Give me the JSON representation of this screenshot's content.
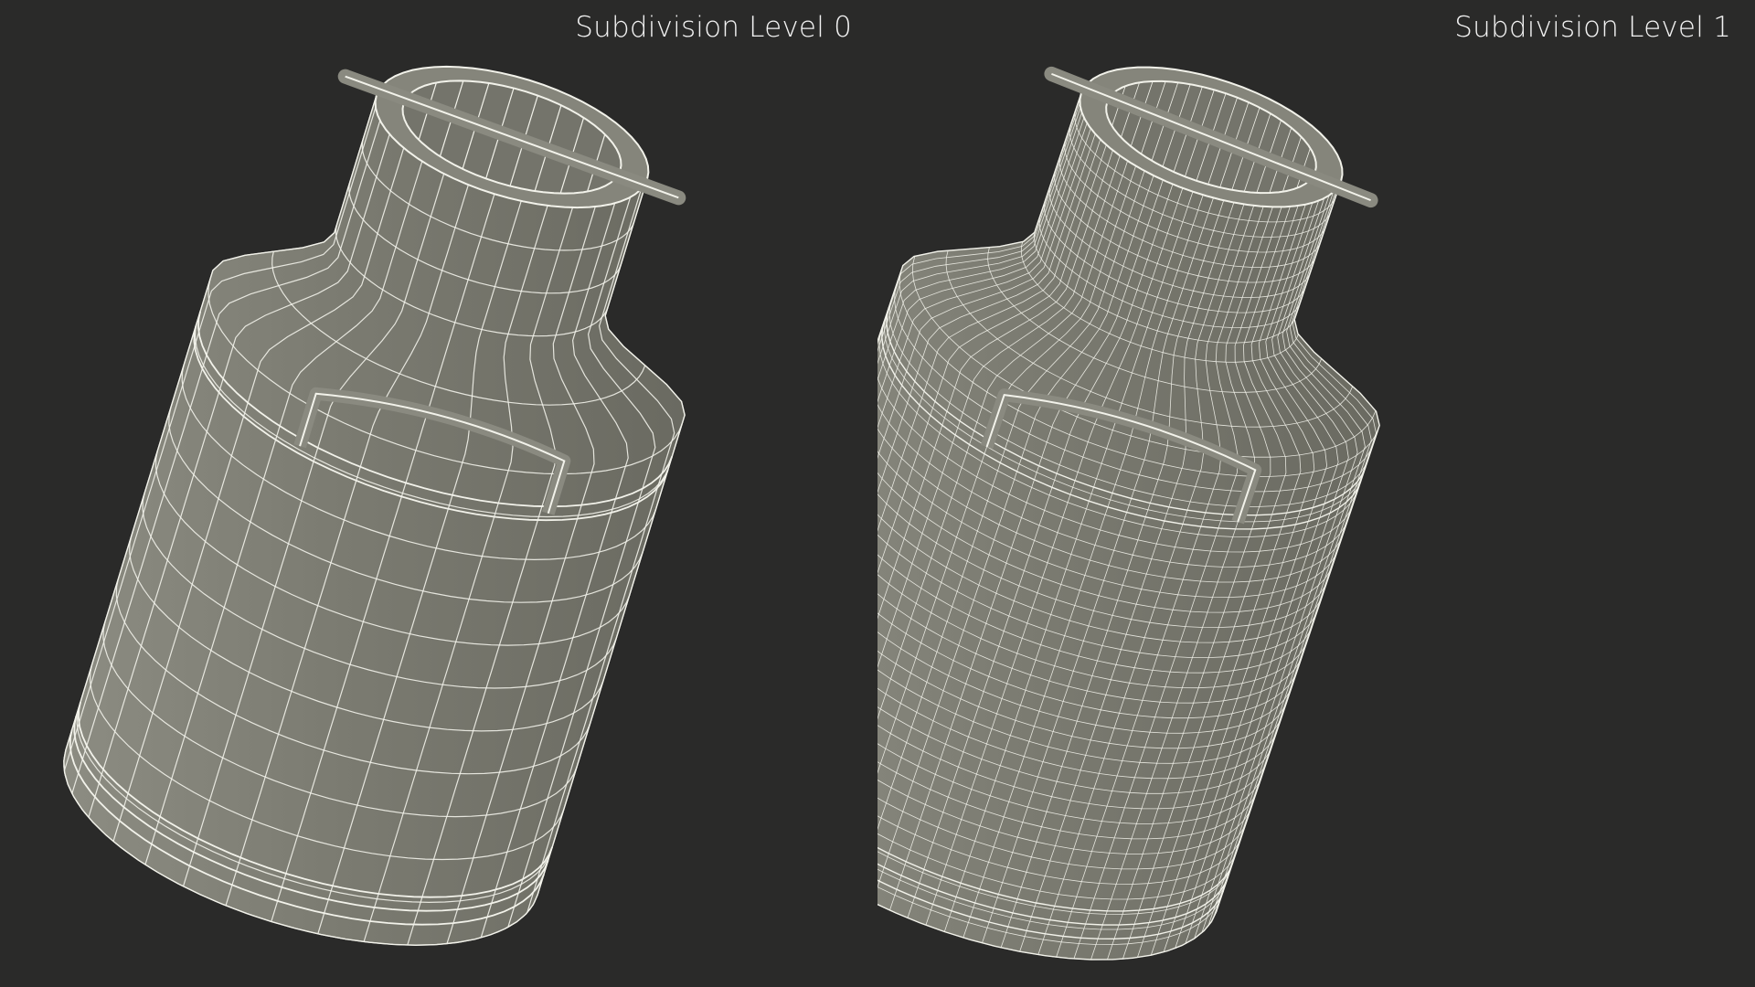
{
  "panels": [
    {
      "label": "Subdivision Level 0",
      "subject": "milk-can-wireframe",
      "wire_density": "low"
    },
    {
      "label": "Subdivision Level 1",
      "subject": "milk-can-wireframe",
      "wire_density": "high"
    }
  ],
  "colors": {
    "background": "#2a2a29",
    "surface": "#7b7b71",
    "wire": "#f2f2ea",
    "label": "#f2f2f2"
  }
}
